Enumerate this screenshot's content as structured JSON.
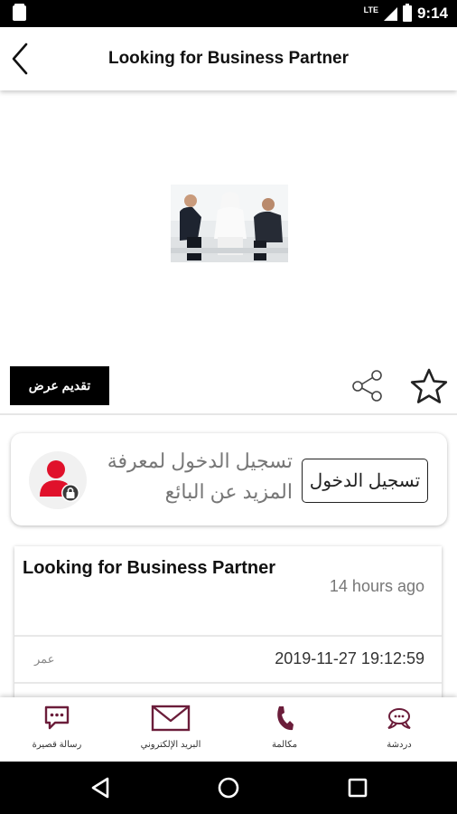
{
  "status_bar": {
    "network_label": "LTE",
    "time": "9:14"
  },
  "app_bar": {
    "title": "Looking for Business Partner",
    "back_icon": "chevron-left-icon"
  },
  "actions": {
    "offer_button_label": "تقديم عرض",
    "share_icon": "share-icon",
    "favorite_icon": "star-outline-icon"
  },
  "login_card": {
    "button_label": "تسجيل الدخول",
    "message": "تسجيل الدخول لمعرفة المزيد عن البائع",
    "avatar_icon": "locked-user-icon"
  },
  "details": {
    "title": "Looking for Business Partner",
    "posted_ago": "14 hours ago",
    "datetime": "2019-11-27 19:12:59",
    "age_label": "عمر"
  },
  "bottom_nav": {
    "items": [
      {
        "label": "رسالة قصيرة",
        "icon": "sms-icon"
      },
      {
        "label": "البريد الإلكتروني",
        "icon": "email-icon"
      },
      {
        "label": "مكالمة",
        "icon": "phone-icon"
      },
      {
        "label": "دردشة",
        "icon": "chat-icon"
      }
    ]
  },
  "colors": {
    "accent": "#6b1d3a",
    "avatar_red": "#e0112b",
    "black": "#000000",
    "muted_text": "#777777"
  }
}
